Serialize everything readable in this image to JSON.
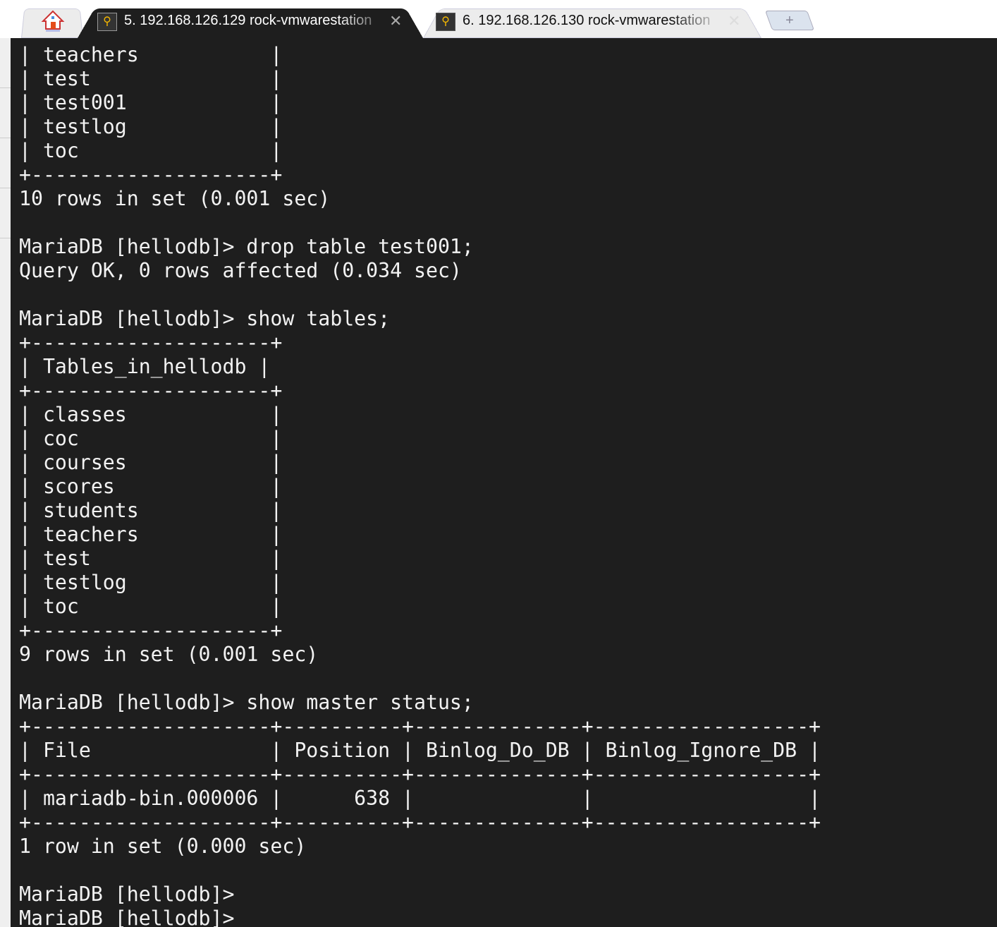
{
  "tabs": [
    {
      "label": "5. 192.168.126.129 rock-vmwarestation",
      "active": true,
      "icon": "key-icon"
    },
    {
      "label": "6. 192.168.126.130 rock-vmwarestation",
      "active": false,
      "icon": "key-icon"
    }
  ],
  "new_tab_label": "+",
  "terminal": {
    "background": "#1e1e1e",
    "foreground": "#f2f2f2",
    "lines": [
      "| teachers           |",
      "| test               |",
      "| test001            |",
      "| testlog            |",
      "| toc                |",
      "+--------------------+",
      "10 rows in set (0.001 sec)",
      "",
      "MariaDB [hellodb]> drop table test001;",
      "Query OK, 0 rows affected (0.034 sec)",
      "",
      "MariaDB [hellodb]> show tables;",
      "+--------------------+",
      "| Tables_in_hellodb |",
      "+--------------------+",
      "| classes            |",
      "| coc                |",
      "| courses            |",
      "| scores             |",
      "| students           |",
      "| teachers           |",
      "| test               |",
      "| testlog            |",
      "| toc                |",
      "+--------------------+",
      "9 rows in set (0.001 sec)",
      "",
      "MariaDB [hellodb]> show master status;",
      "+--------------------+----------+--------------+------------------+",
      "| File               | Position | Binlog_Do_DB | Binlog_Ignore_DB |",
      "+--------------------+----------+--------------+------------------+",
      "| mariadb-bin.000006 |      638 |              |                  |",
      "+--------------------+----------+--------------+------------------+",
      "1 row in set (0.000 sec)",
      "",
      "MariaDB [hellodb]>",
      "MariaDB [hellodb]>"
    ]
  }
}
